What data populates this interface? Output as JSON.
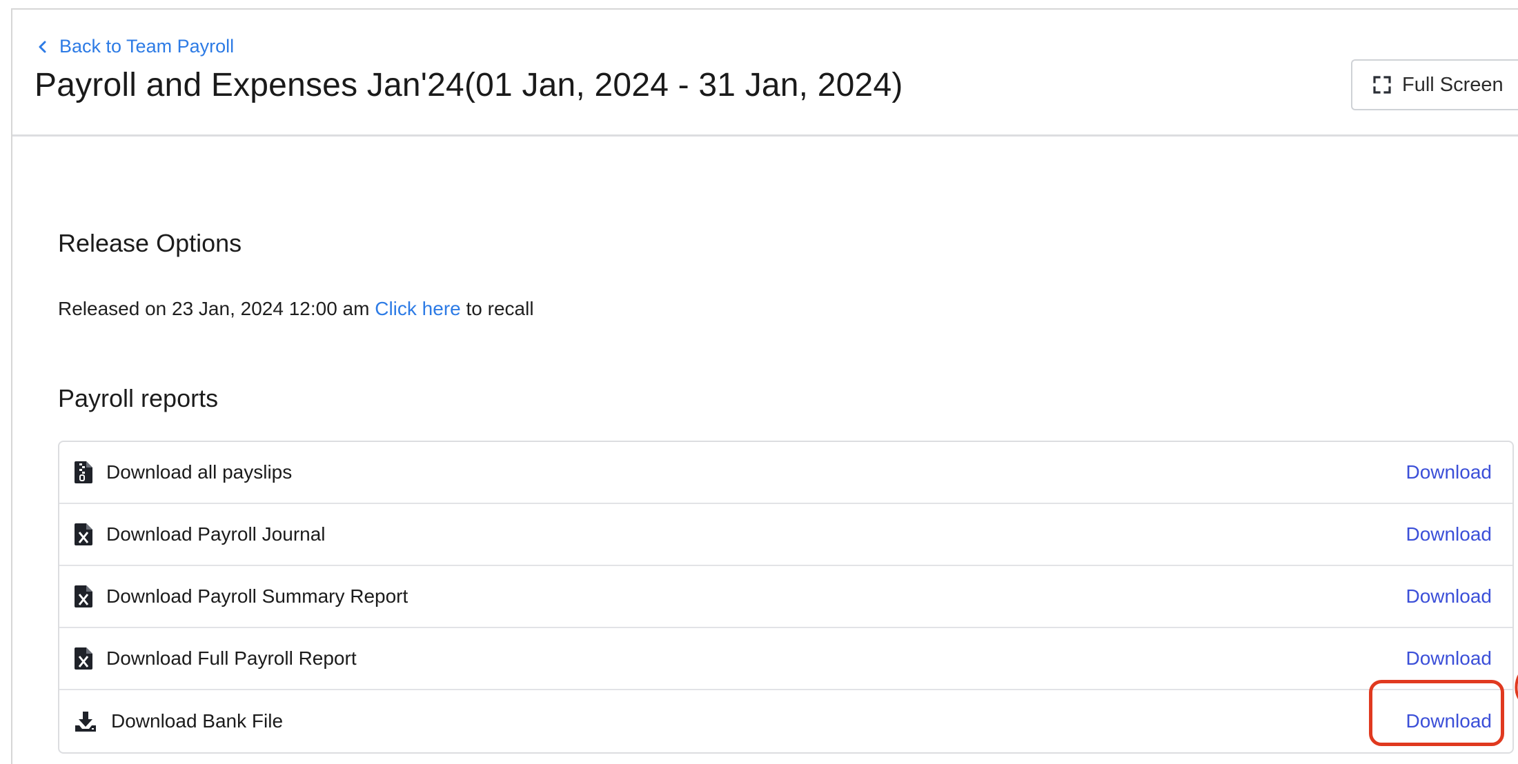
{
  "header": {
    "back_label": "Back to Team Payroll",
    "title": "Payroll and Expenses Jan'24(01 Jan, 2024 - 31 Jan, 2024)",
    "fullscreen_label": "Full Screen"
  },
  "release": {
    "heading": "Release Options",
    "prefix": "Released on 23 Jan, 2024 12:00 am ",
    "link": "Click here",
    "suffix": " to recall"
  },
  "reports": {
    "heading": "Payroll reports",
    "items": [
      {
        "label": "Download all payslips",
        "icon": "zip-file-icon",
        "action": "Download"
      },
      {
        "label": "Download Payroll Journal",
        "icon": "excel-file-icon",
        "action": "Download"
      },
      {
        "label": "Download Payroll Summary Report",
        "icon": "excel-file-icon",
        "action": "Download"
      },
      {
        "label": "Download Full Payroll Report",
        "icon": "excel-file-icon",
        "action": "Download"
      },
      {
        "label": "Download Bank File",
        "icon": "download-tray-icon",
        "action": "Download"
      }
    ]
  },
  "colors": {
    "link": "#2d7be5",
    "download": "#3b4fd8",
    "highlight": "#e0391f"
  }
}
